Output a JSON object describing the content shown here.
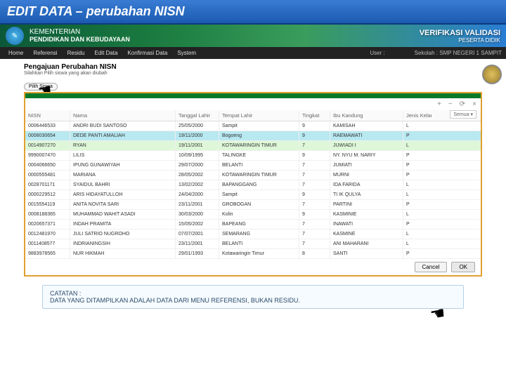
{
  "title_bar": "EDIT DATA – perubahan NISN",
  "ministry": {
    "line1": "KEMENTERIAN",
    "line2": "PENDIDIKAN DAN KEBUDAYAAN"
  },
  "vv": {
    "line1": "VERIFIKASI VALIDASI",
    "line2": "PESERTA DIDIK"
  },
  "menu": {
    "items": [
      "Home",
      "Referensi",
      "Residu",
      "Edit Data",
      "Konfirmasi Data",
      "System"
    ],
    "user_label": "User :",
    "school_label": "Sekolah : SMP NEGERI 1 SAMPIT"
  },
  "page": {
    "title": "Pengajuan Perubahan NISN",
    "sub": "Silahkan Pilih siswa yang akan diubah",
    "pill": "Pilih Siswa"
  },
  "win_icons": [
    "+",
    "−",
    "⟳",
    "×"
  ],
  "columns": [
    "NISN",
    "Nama",
    "Tanggal Lahir",
    "Tempat Lahir",
    "Tingkat",
    "Ibu Kandung",
    "Jenis Kelamin"
  ],
  "semua": "Semua ▾",
  "rows": [
    {
      "nisn": "0006446533",
      "nama": "ANDRI BUDI SANTOSO",
      "tgl": "25/05/2000",
      "tmp": "Sampit",
      "tk": "9",
      "ibu": "KAMISAH",
      "jk": "L"
    },
    {
      "nisn": "0008030654",
      "nama": "DEDE PANTI AMALIAH",
      "tgl": "19/11/2000",
      "tmp": "Bogoeng",
      "tk": "9",
      "ibu": "RAEMAWATI",
      "jk": "P"
    },
    {
      "nisn": "0014907270",
      "nama": "RYAN",
      "tgl": "19/11/2001",
      "tmp": "KOTAWARINGIN TIMUR",
      "tk": "7",
      "ibu": "JUWIADI I",
      "jk": "L"
    },
    {
      "nisn": "9990007470",
      "nama": "LILIS",
      "tgl": "10/09/1995",
      "tmp": "TALINGKE",
      "tk": "9",
      "ibu": "NY. NYU M. NARIY",
      "jk": "P"
    },
    {
      "nisn": "0004066650",
      "nama": "IPUNG GUNAWIYAH",
      "tgl": "29/07/2000",
      "tmp": "BELANTI",
      "tk": "7",
      "ibu": "JUMIATI",
      "jk": "P"
    },
    {
      "nisn": "0000555481",
      "nama": "MARIANA",
      "tgl": "28/05/2002",
      "tmp": "KOTAWARINGIN TIMUR",
      "tk": "7",
      "ibu": "MURNI",
      "jk": "P"
    },
    {
      "nisn": "0028701171",
      "nama": "SYAIDUL BAHRI",
      "tgl": "13/02/2002",
      "tmp": "BAPANGGANG",
      "tk": "7",
      "ibu": "IDA FARIDA",
      "jk": "L"
    },
    {
      "nisn": "0000229512",
      "nama": "ARIS HIDAYATULLOH",
      "tgl": "24/04/2000",
      "tmp": "Sampit",
      "tk": "9",
      "ibu": "TI IK QULYA",
      "jk": "L"
    },
    {
      "nisn": "0015554119",
      "nama": "ANITA NOVITA SARI",
      "tgl": "23/11/2001",
      "tmp": "GROBOGAN",
      "tk": "7",
      "ibu": "PARTINI",
      "jk": "P"
    },
    {
      "nisn": "0008188365",
      "nama": "MUHAMMAD WAHIT ASADI",
      "tgl": "30/03/2000",
      "tmp": "Kolin",
      "tk": "9",
      "ibu": "KASMINIE",
      "jk": "L"
    },
    {
      "nisn": "0020657371",
      "nama": "INDAH PRAMITA",
      "tgl": "15/05/2002",
      "tmp": "BAPEANG",
      "tk": "7",
      "ibu": "INAWATI",
      "jk": "P"
    },
    {
      "nisn": "0012481970",
      "nama": "JULI SATRIO NUGROHO",
      "tgl": "07/07/2001",
      "tmp": "SEMARANG",
      "tk": "7",
      "ibu": "KASMINE",
      "jk": "L"
    },
    {
      "nisn": "0011408577",
      "nama": "INDRIANINGSIH",
      "tgl": "23/11/2001",
      "tmp": "BELANTI",
      "tk": "7",
      "ibu": "ANI MAHARANI",
      "jk": "L"
    },
    {
      "nisn": "9883978565",
      "nama": "NUR HIKMAH",
      "tgl": "29/01/1993",
      "tmp": "Kotawaringin Timur",
      "tk": "8",
      "ibu": "SANTI",
      "jk": "P"
    }
  ],
  "buttons": {
    "cancel": "Cancel",
    "ok": "OK"
  },
  "note": {
    "t": "CATATAN :",
    "b": "DATA YANG DITAMPILKAN ADALAH DATA DARI MENU REFERENSI, BUKAN RESIDU."
  }
}
